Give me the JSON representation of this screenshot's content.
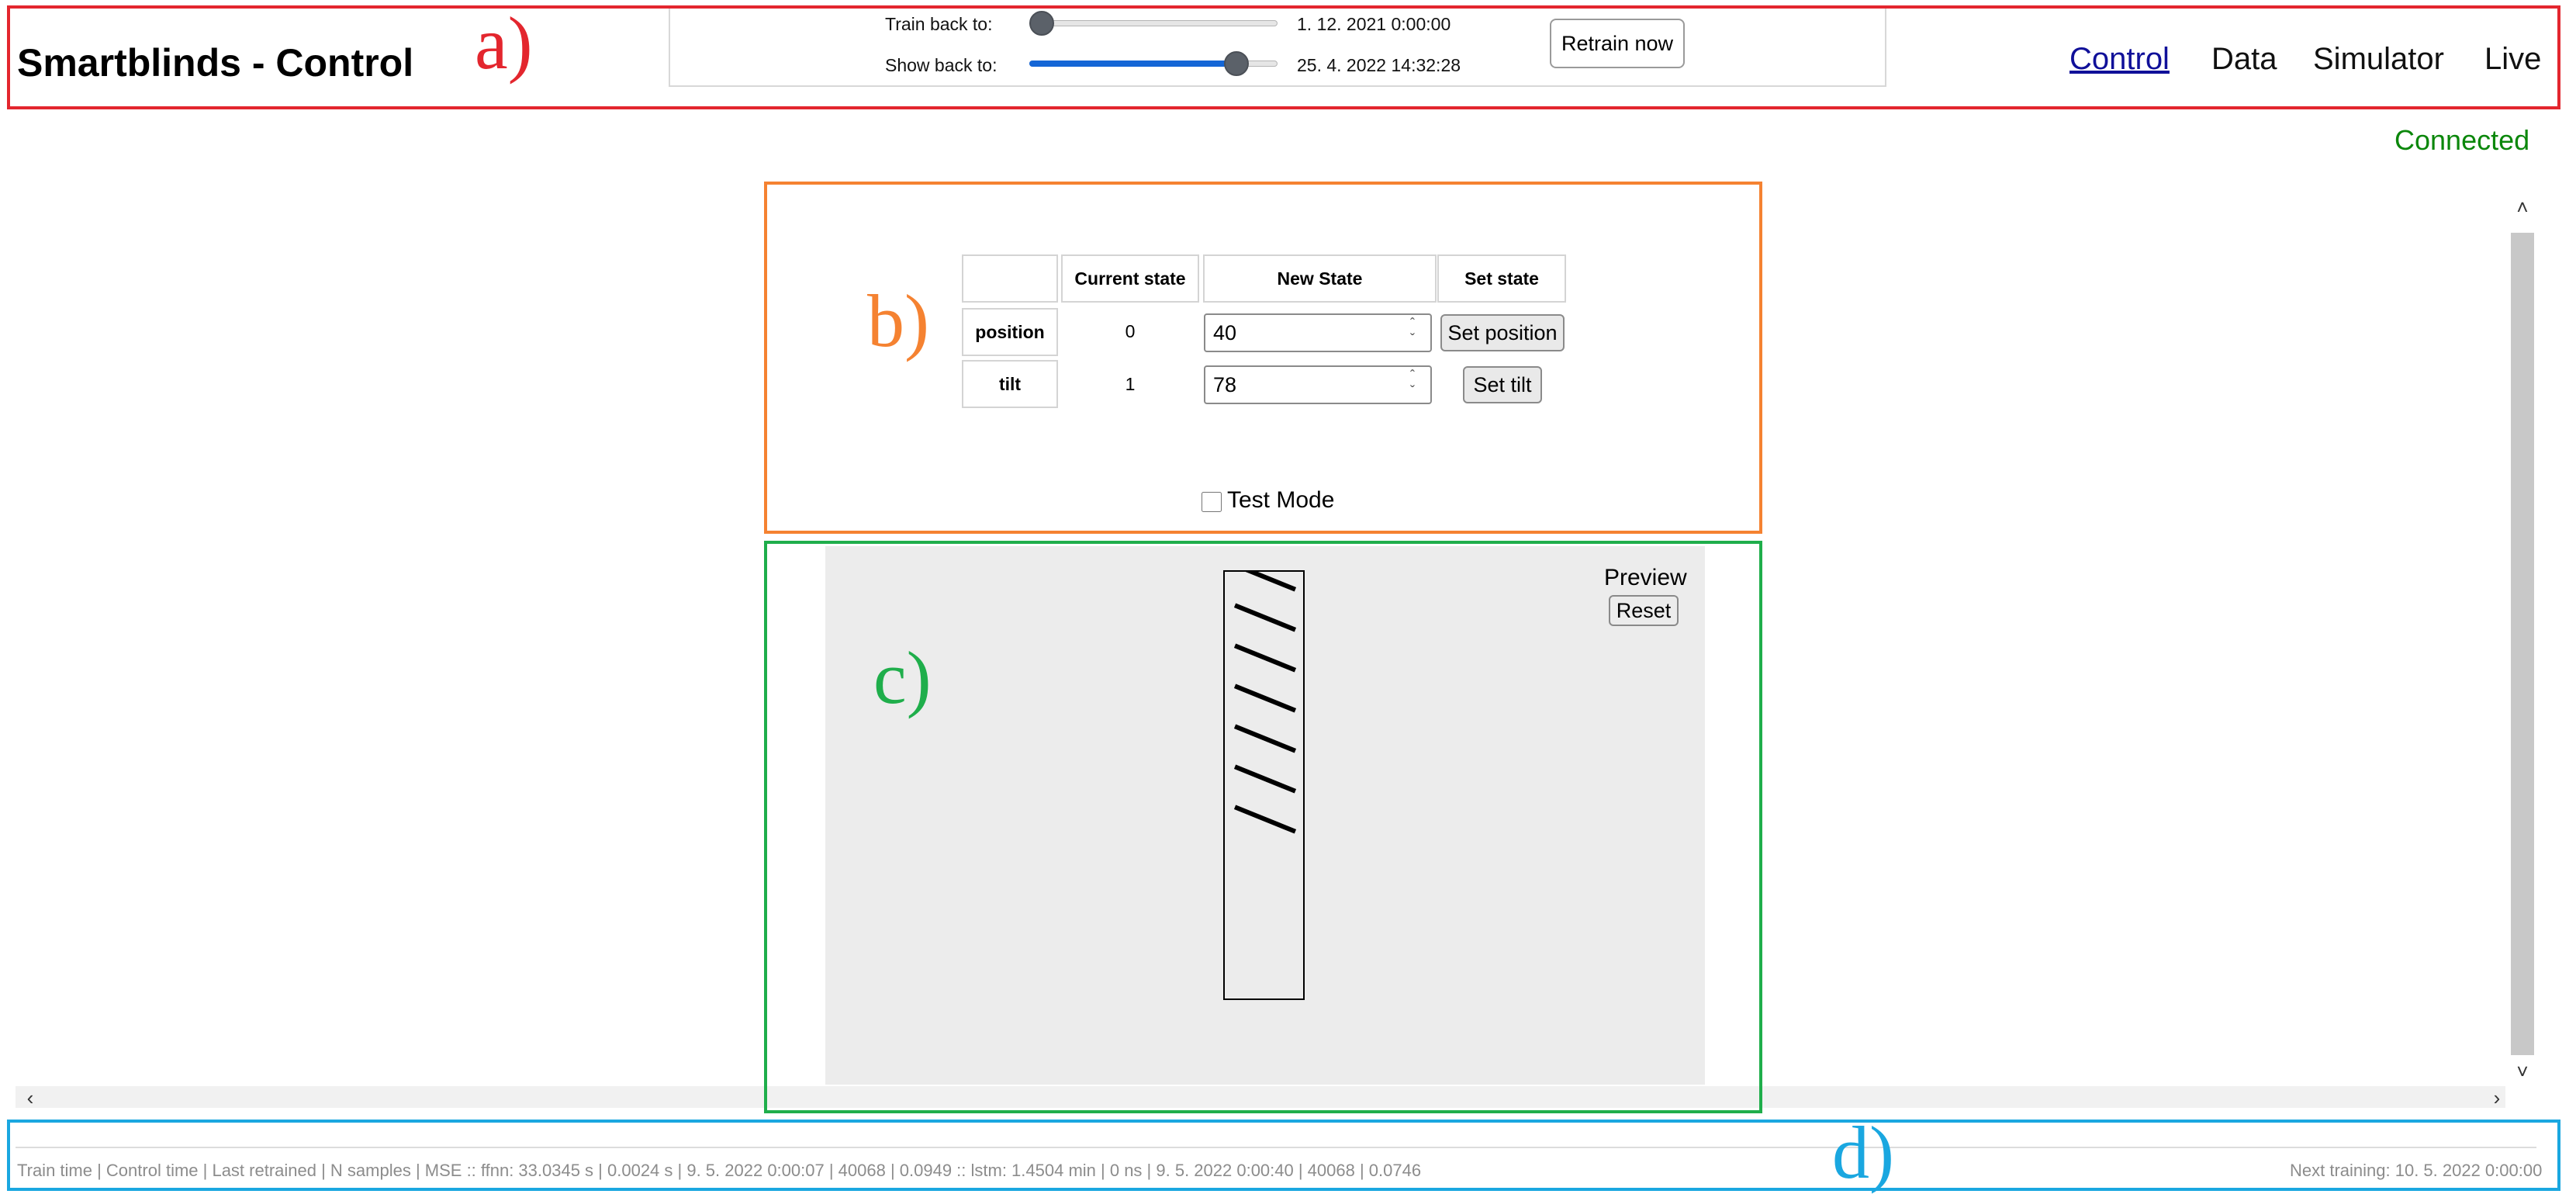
{
  "header": {
    "app_title": "Smartblinds - Control",
    "train_back": {
      "label": "Train back to:",
      "value": "1. 12. 2021 0:00:00",
      "slider_fraction": 0.0
    },
    "show_back": {
      "label": "Show back to:",
      "value": "25. 4. 2022 14:32:28",
      "slider_fraction": 0.87
    },
    "retrain_label": "Retrain now",
    "nav": {
      "control": "Control",
      "data": "Data",
      "simulator": "Simulator",
      "live": "Live"
    }
  },
  "status": {
    "connection": "Connected"
  },
  "control_table": {
    "headers": [
      "Current state",
      "New State",
      "Set state"
    ],
    "rows": [
      {
        "name": "position",
        "current": "0",
        "new": "40",
        "button": "Set position"
      },
      {
        "name": "tilt",
        "current": "1",
        "new": "78",
        "button": "Set tilt"
      }
    ],
    "test_mode_label": "Test Mode",
    "test_mode_checked": false
  },
  "preview": {
    "label": "Preview",
    "reset_label": "Reset",
    "slat_count": 7
  },
  "footer": {
    "stats": "Train time | Control time | Last retrained | N samples | MSE :: ffnn: 33.0345 s | 0.0024 s | 9. 5. 2022 0:00:07 | 40068 | 0.0949 :: lstm: 1.4504 min | 0 ns | 9. 5. 2022 0:00:40 | 40068 | 0.0746",
    "next_training": "Next training: 10. 5. 2022 0:00:00"
  },
  "annotations": {
    "a": {
      "label": "a)",
      "color": "#e3262e"
    },
    "b": {
      "label": "b)",
      "color": "#f58231"
    },
    "c": {
      "label": "c)",
      "color": "#1fae4b"
    },
    "d": {
      "label": "d)",
      "color": "#1aa7e0"
    }
  },
  "colors": {
    "slider_fill": "#1466d6",
    "connected": "#0b870b",
    "active_nav": "#101099"
  }
}
